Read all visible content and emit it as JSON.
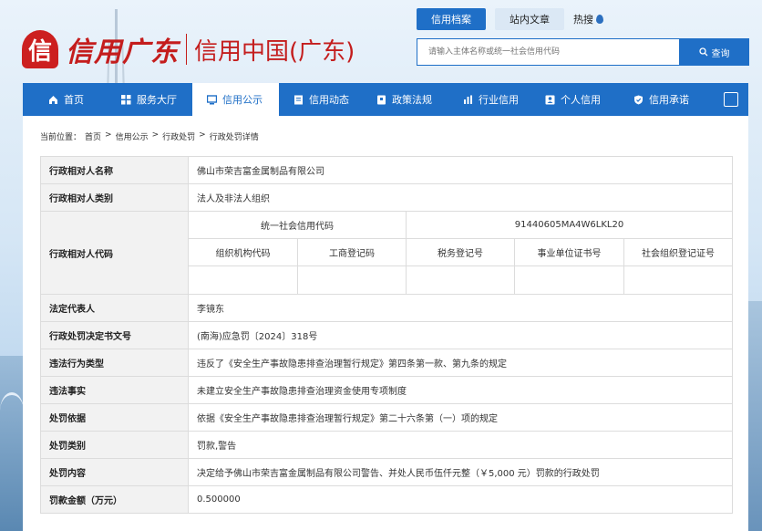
{
  "header": {
    "logo_mark": "信",
    "logo_calligraphy": "信用广东",
    "site_name": "信用中国(广东)",
    "top_tabs": [
      {
        "label": "信用档案",
        "active": true
      },
      {
        "label": "站内文章",
        "active": false
      }
    ],
    "hot_label": "热搜",
    "search": {
      "placeholder": "请输入主体名称或统一社会信用代码",
      "button_label": "查询"
    }
  },
  "nav": {
    "items": [
      {
        "label": "首页",
        "icon": "home-icon"
      },
      {
        "label": "服务大厅",
        "icon": "grid-icon"
      },
      {
        "label": "信用公示",
        "icon": "monitor-icon",
        "active": true
      },
      {
        "label": "信用动态",
        "icon": "document-icon"
      },
      {
        "label": "政策法规",
        "icon": "book-icon"
      },
      {
        "label": "行业信用",
        "icon": "chart-icon"
      },
      {
        "label": "个人信用",
        "icon": "person-icon"
      },
      {
        "label": "信用承诺",
        "icon": "shield-icon"
      }
    ]
  },
  "breadcrumb": {
    "prefix": "当前位置：",
    "items": [
      "首页",
      "信用公示",
      "行政处罚",
      "行政处罚详情"
    ],
    "separator": ">"
  },
  "detail": {
    "rows": [
      {
        "label": "行政相对人名称",
        "value": "佛山市荣吉富金属制品有限公司"
      },
      {
        "label": "行政相对人类别",
        "value": "法人及非法人组织"
      }
    ],
    "code_block": {
      "label": "行政相对人代码",
      "usc_label": "统一社会信用代码",
      "usc_value": "91440605MA4W6LKL20",
      "sub_headers": [
        "组织机构代码",
        "工商登记码",
        "税务登记号",
        "事业单位证书号",
        "社会组织登记证号"
      ],
      "sub_values": [
        "",
        "",
        "",
        "",
        ""
      ]
    },
    "rows2": [
      {
        "label": "法定代表人",
        "value": "李镜东"
      },
      {
        "label": "行政处罚决定书文号",
        "value": "(南海)应急罚〔2024〕318号"
      },
      {
        "label": "违法行为类型",
        "value": "违反了《安全生产事故隐患排查治理暂行规定》第四条第一款、第九条的规定"
      },
      {
        "label": "违法事实",
        "value": "未建立安全生产事故隐患排查治理资金使用专项制度"
      },
      {
        "label": "处罚依据",
        "value": "依据《安全生产事故隐患排查治理暂行规定》第二十六条第（一）项的规定"
      },
      {
        "label": "处罚类别",
        "value": "罚款,警告"
      },
      {
        "label": "处罚内容",
        "value": "决定给予佛山市荣吉富金属制品有限公司警告、并处人民币伍仟元整（￥5,000 元）罚款的行政处罚"
      },
      {
        "label": "罚款金额（万元）",
        "value": "0.500000"
      }
    ]
  },
  "colors": {
    "brand_blue": "#1f6fc7",
    "brand_red": "#c41d1d",
    "label_bg": "#f2f2f2"
  }
}
